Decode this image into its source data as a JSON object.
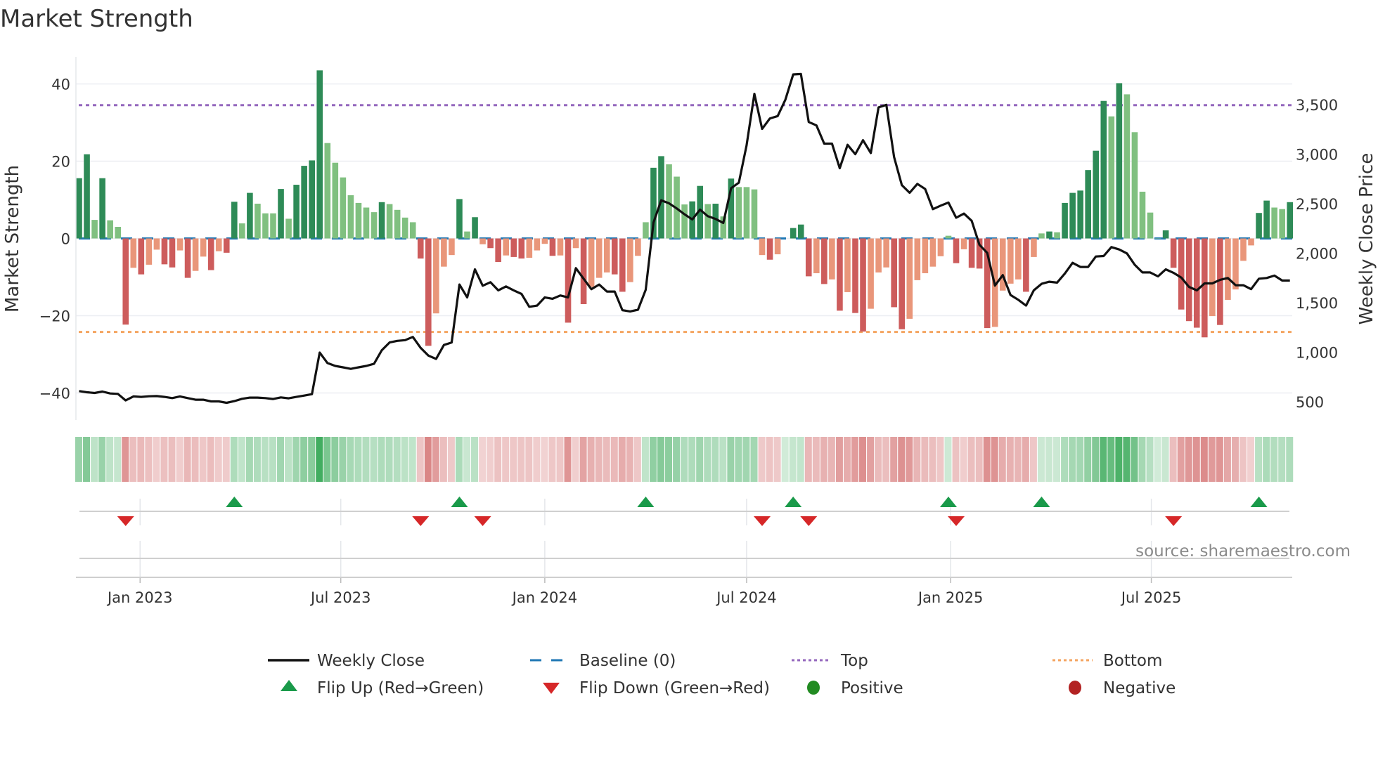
{
  "chart_data": {
    "type": "bar",
    "title": "Market Strength",
    "ylabel_left": "Market Strength",
    "ylabel_right": "Weekly Close Price",
    "ylim_left": [
      -47,
      47
    ],
    "ylim_right": [
      316,
      3982
    ],
    "left_ticks": [
      40,
      20,
      0,
      -20,
      -40
    ],
    "left_tick_labels": [
      "40",
      "20",
      "0",
      "−20",
      "−40"
    ],
    "right_ticks": [
      500,
      1000,
      1500,
      2000,
      2500,
      3000,
      3500
    ],
    "right_tick_labels": [
      "500",
      "1,000",
      "1,500",
      "2,000",
      "2,500",
      "3,000",
      "3,500"
    ],
    "x_start_week": "2022-11-07",
    "x_ticks": [
      {
        "date": "2023-01-01",
        "label": "Jan 2023"
      },
      {
        "date": "2023-07-01",
        "label": "Jul 2023"
      },
      {
        "date": "2024-01-01",
        "label": "Jan 2024"
      },
      {
        "date": "2024-07-01",
        "label": "Jul 2024"
      },
      {
        "date": "2025-01-01",
        "label": "Jan 2025"
      },
      {
        "date": "2025-07-01",
        "label": "Jul 2025"
      }
    ],
    "top_level": 34.5,
    "bottom_level": -24.2,
    "grid": true,
    "legend_position": "bottom",
    "strength": [
      15.6,
      21.8,
      4.8,
      15.6,
      4.7,
      3.0,
      -22.3,
      -7.6,
      -9.3,
      -6.8,
      -2.9,
      -6.7,
      -7.5,
      -3.1,
      -10.2,
      -8.4,
      -4.7,
      -8.2,
      -3.3,
      -3.7,
      9.5,
      3.9,
      11.8,
      9.0,
      6.5,
      6.5,
      12.8,
      5.1,
      13.9,
      18.8,
      20.2,
      43.5,
      24.7,
      19.6,
      15.8,
      11.2,
      9.2,
      8.0,
      6.8,
      9.4,
      8.9,
      7.4,
      5.4,
      4.2,
      -5.2,
      -27.8,
      -19.4,
      -7.3,
      -4.3,
      10.2,
      1.8,
      5.5,
      -1.5,
      -2.5,
      -6.1,
      -4.4,
      -4.8,
      -5.2,
      -5.0,
      -3.1,
      -1.4,
      -4.5,
      -4.4,
      -21.8,
      -2.5,
      -17.0,
      -12.6,
      -10.2,
      -8.8,
      -9.3,
      -13.8,
      -11.3,
      -4.5,
      4.2,
      18.3,
      21.3,
      19.2,
      16.0,
      8.8,
      9.6,
      13.6,
      8.9,
      9.0,
      5.7,
      15.5,
      13.3,
      13.3,
      12.7,
      -4.3,
      -5.5,
      -4.1,
      0,
      2.7,
      3.6,
      -9.8,
      -9.0,
      -11.8,
      -10.6,
      -18.7,
      -13.9,
      -19.3,
      -24.1,
      -18.2,
      -8.8,
      -7.5,
      -17.8,
      -23.5,
      -20.8,
      -10.8,
      -9.0,
      -7.3,
      -4.6,
      0.7,
      -6.4,
      -2.8,
      -7.6,
      -7.8,
      -23.2,
      -22.9,
      -13.5,
      -11.7,
      -10.6,
      -13.8,
      -4.8,
      1.3,
      1.8,
      1.6,
      9.2,
      11.8,
      12.4,
      17.7,
      22.7,
      35.6,
      31.6,
      40.2,
      37.3,
      27.5,
      12.1,
      6.7,
      0.1,
      2.1,
      -7.6,
      -18.4,
      -21.4,
      -23.1,
      -25.6,
      -20.1,
      -22.4,
      -15.9,
      -13.2,
      -5.8,
      -1.8,
      6.6,
      9.8,
      8.0,
      7.6,
      9.4
    ],
    "weekly_close": [
      608,
      596,
      589,
      603,
      584,
      580,
      514,
      554,
      549,
      556,
      558,
      549,
      537,
      554,
      537,
      521,
      521,
      504,
      504,
      490,
      507,
      530,
      542,
      542,
      537,
      528,
      544,
      535,
      549,
      563,
      577,
      997,
      891,
      862,
      848,
      832,
      848,
      862,
      884,
      1021,
      1099,
      1115,
      1122,
      1155,
      1044,
      966,
      933,
      1073,
      1099,
      1684,
      1554,
      1837,
      1672,
      1707,
      1625,
      1665,
      1625,
      1589,
      1459,
      1471,
      1554,
      1540,
      1573,
      1554,
      1849,
      1743,
      1637,
      1684,
      1613,
      1613,
      1424,
      1412,
      1429,
      1630,
      2310,
      2534,
      2504,
      2452,
      2393,
      2341,
      2440,
      2374,
      2346,
      2306,
      2657,
      2712,
      3089,
      3609,
      3255,
      3361,
      3384,
      3550,
      3805,
      3809,
      3325,
      3290,
      3106,
      3106,
      2858,
      3094,
      3000,
      3141,
      3011,
      3472,
      3498,
      2971,
      2688,
      2610,
      2700,
      2648,
      2445,
      2480,
      2511,
      2358,
      2400,
      2327,
      2085,
      2003,
      1673,
      1779,
      1578,
      1530,
      1471,
      1625,
      1691,
      1712,
      1703,
      1795,
      1903,
      1861,
      1861,
      1967,
      1972,
      2062,
      2038,
      1998,
      1884,
      1806,
      1806,
      1766,
      1837,
      1802,
      1754,
      1660,
      1625,
      1695,
      1695,
      1731,
      1750,
      1677,
      1677,
      1637,
      1743,
      1750,
      1774,
      1724,
      1724
    ]
  },
  "colors": {
    "pos_strong": "#2e8b57",
    "pos_weak": "#80c080",
    "neg_strong": "#cd5c5c",
    "neg_weak": "#e9967a",
    "close_line": "#111111",
    "baseline": "#1f77b4",
    "top": "#9467bd",
    "bottom": "#f4a460",
    "flip_up": "#1a9a4a",
    "flip_down": "#d62728",
    "positive": "#228b22",
    "negative": "#b22222"
  },
  "legend": {
    "weekly_close": "Weekly Close",
    "baseline": "Baseline (0)",
    "top": "Top",
    "bottom": "Bottom",
    "flip_up": "Flip Up (Red→Green)",
    "flip_down": "Flip Down (Green→Red)",
    "positive": "Positive",
    "negative": "Negative"
  },
  "source": "source: sharemaestro.com"
}
